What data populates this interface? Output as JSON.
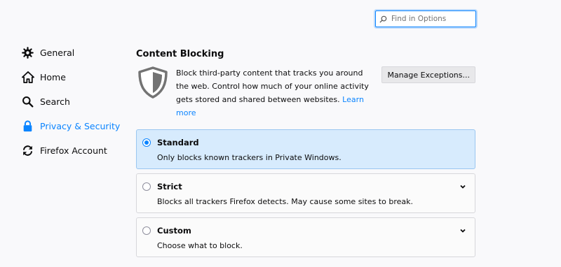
{
  "search": {
    "placeholder": "Find in Options"
  },
  "sidebar": {
    "items": [
      {
        "label": "General",
        "icon": "gear-icon"
      },
      {
        "label": "Home",
        "icon": "home-icon"
      },
      {
        "label": "Search",
        "icon": "search-icon"
      },
      {
        "label": "Privacy & Security",
        "icon": "lock-icon",
        "active": true
      },
      {
        "label": "Firefox Account",
        "icon": "sync-icon"
      }
    ]
  },
  "content_blocking": {
    "title": "Content Blocking",
    "description": "Block third-party content that tracks you around the web. Control how much of your online activity gets stored and shared between websites.",
    "learn_more": "Learn more",
    "manage_exceptions": "Manage Exceptions...",
    "options": [
      {
        "title": "Standard",
        "description": "Only blocks known trackers in Private Windows.",
        "selected": true
      },
      {
        "title": "Strict",
        "description": "Blocks all trackers Firefox detects. May cause some sites to break.",
        "selected": false
      },
      {
        "title": "Custom",
        "description": "Choose what to block.",
        "selected": false
      }
    ]
  },
  "colors": {
    "accent": "#0a84ff",
    "selected_bg": "#d7ebfd"
  }
}
